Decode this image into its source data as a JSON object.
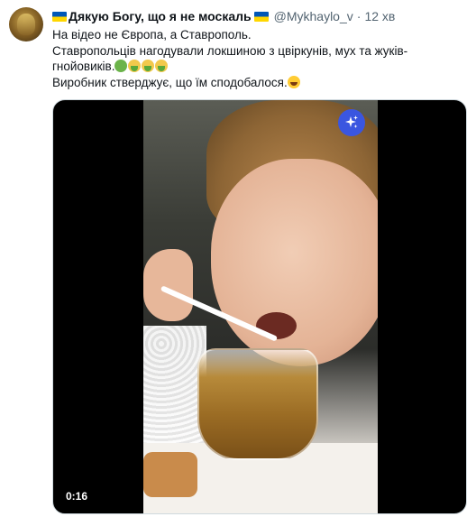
{
  "tweet": {
    "display_name": "Дякую Богу, що я не москаль",
    "handle": "@Mykhaylo_v",
    "separator": "·",
    "time": "12 хв",
    "lines": [
      "На відео не Європа, а Ставрополь.",
      "Ставропольців нагодували локшиною з цвіркунів, мух та жуків-",
      "гнойовиків.",
      "Виробник стверджує, що їм сподобалося."
    ],
    "emojis_line3": [
      "nauseated-face",
      "vomiting-face",
      "vomiting-face",
      "vomiting-face"
    ],
    "emoji_line4": "laughing-with-tears-face"
  },
  "media": {
    "duration": "0:16",
    "ai_icon": "sparkle-icon"
  },
  "colors": {
    "flag_blue": "#0057b7",
    "flag_yellow": "#ffd700",
    "sparkle_bg": "#3a56e0",
    "secondary_text": "#536471"
  }
}
